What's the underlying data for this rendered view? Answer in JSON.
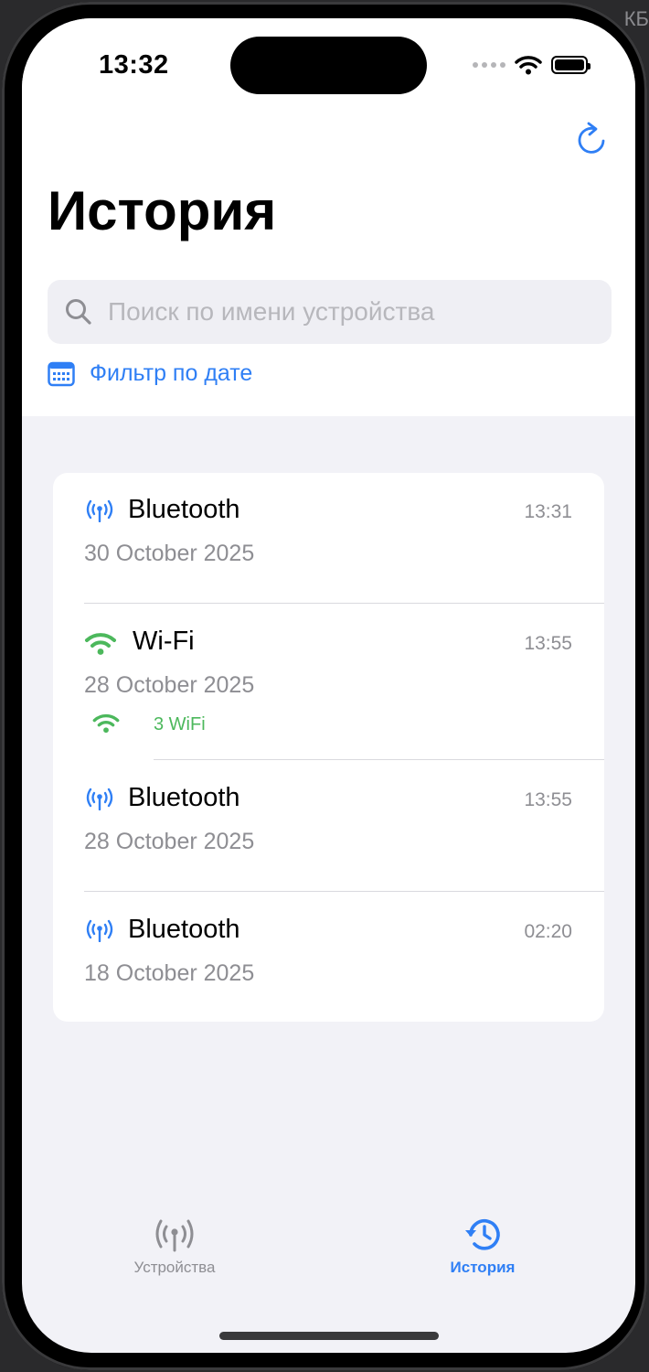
{
  "corner_text": "КБ",
  "status_bar": {
    "time": "13:32"
  },
  "header": {
    "title": "История"
  },
  "search": {
    "placeholder": "Поиск по имени устройства",
    "value": ""
  },
  "date_filter": {
    "label": "Фильтр по дате"
  },
  "history": [
    {
      "type": "bluetooth",
      "title": "Bluetooth",
      "date": "30 October 2025",
      "time": "13:31"
    },
    {
      "type": "wifi",
      "title": "Wi-Fi",
      "date": "28 October 2025",
      "time": "13:55",
      "sub": "3 WiFi"
    },
    {
      "type": "bluetooth",
      "title": "Bluetooth",
      "date": "28 October 2025",
      "time": "13:55"
    },
    {
      "type": "bluetooth",
      "title": "Bluetooth",
      "date": "18 October 2025",
      "time": "02:20"
    }
  ],
  "tabs": [
    {
      "label": "Устройства",
      "icon": "antenna-icon",
      "selected": false
    },
    {
      "label": "История",
      "icon": "history-icon",
      "selected": true
    }
  ],
  "colors": {
    "accent": "#2f7ff5",
    "wifi_green": "#4cb85c",
    "muted": "#8e8e93",
    "tab_inactive": "#8e8e93"
  }
}
